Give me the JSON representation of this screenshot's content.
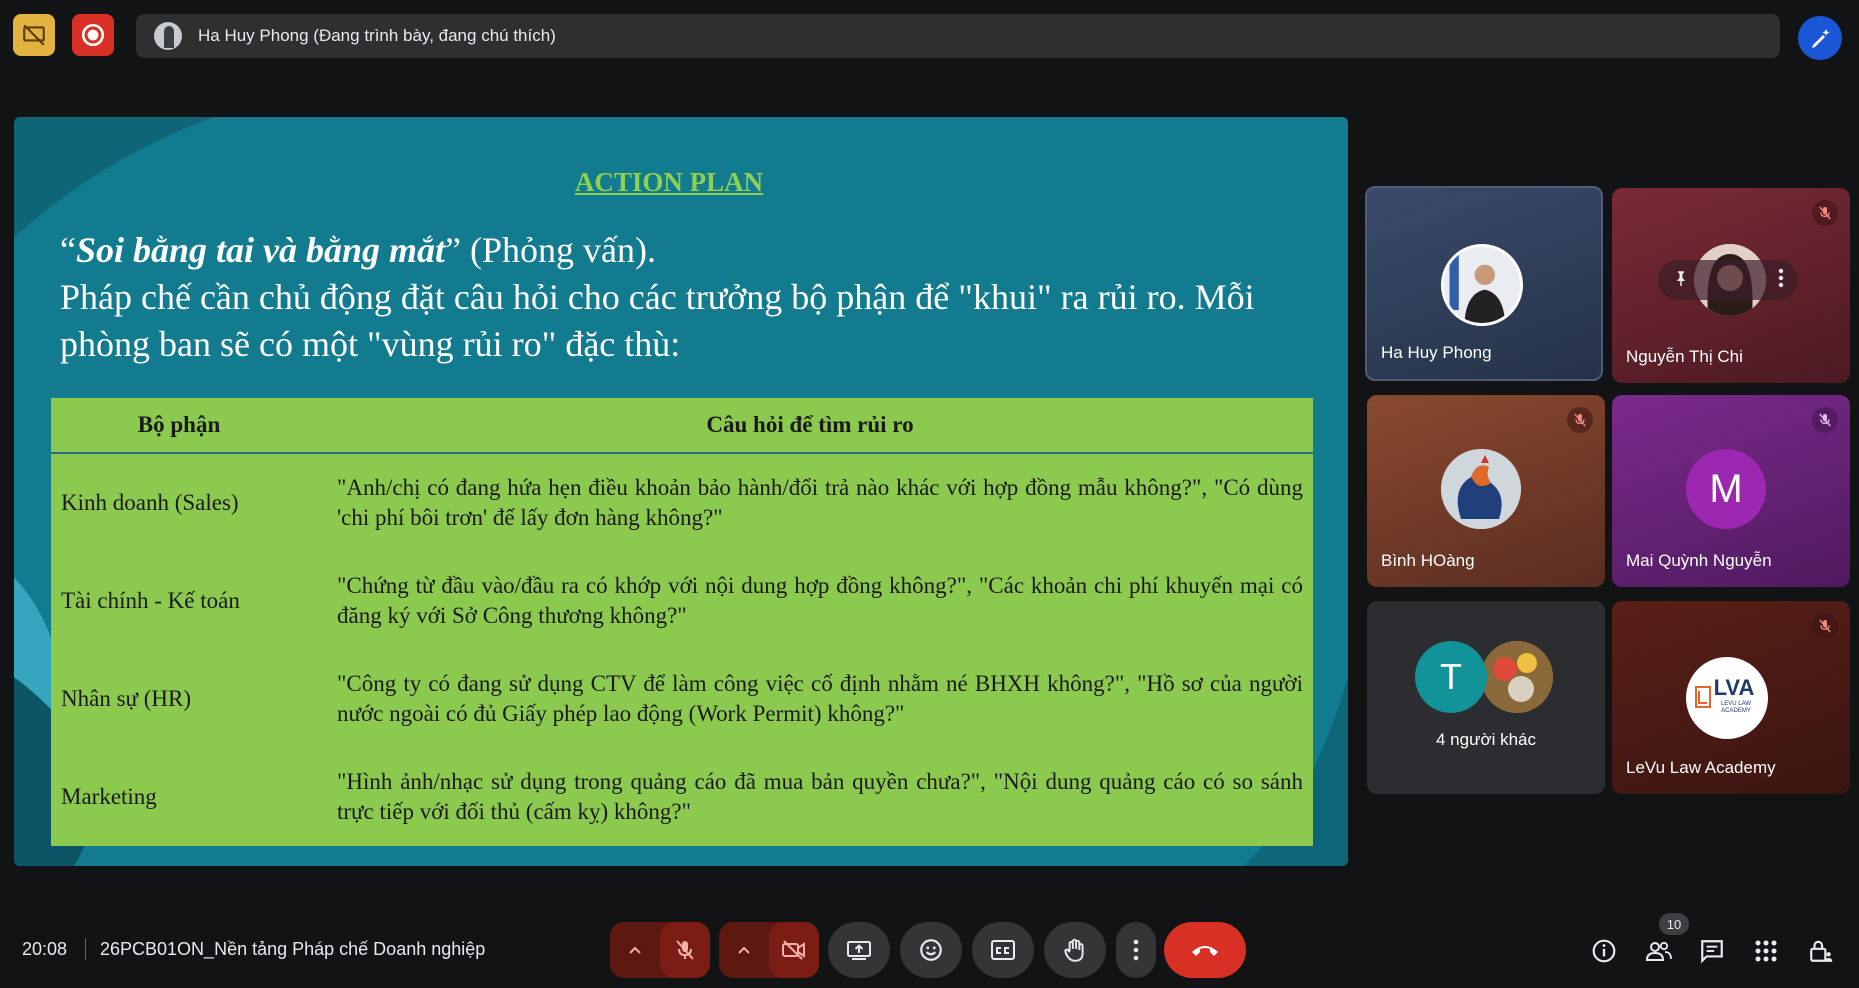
{
  "presenter_bar": {
    "text": "Ha Huy Phong (Đang trình bày, đang chú thích)"
  },
  "slide": {
    "title": "ACTION PLAN",
    "body_open_quote": "“",
    "body_emphasis": "Soi bằng tai và bằng mắt",
    "body_after_emphasis": "” (Phỏng vấn).",
    "body_line2": "Pháp chế cần chủ động đặt câu hỏi cho các trưởng bộ phận để \"khui\" ra rủi ro. Mỗi phòng ban sẽ có một \"vùng rủi ro\" đặc thù:",
    "table": {
      "headers": [
        "Bộ phận",
        "Câu hỏi để tìm rủi ro"
      ],
      "rows": [
        {
          "dept": "Kinh doanh (Sales)",
          "question": "\"Anh/chị có đang hứa hẹn điều khoản bảo hành/đổi trả nào khác với hợp đồng mẫu không?\", \"Có dùng 'chi phí bôi trơn' để lấy đơn hàng không?\""
        },
        {
          "dept": "Tài chính - Kế toán",
          "question": "\"Chứng từ đầu vào/đầu ra có khớp với nội dung hợp đồng không?\", \"Các khoản chi phí khuyến mại có đăng ký với Sở Công thương không?\""
        },
        {
          "dept": "Nhân sự (HR)",
          "question": "\"Công ty có đang sử dụng CTV để làm công việc cố định nhằm né BHXH không?\", \"Hồ sơ của người nước ngoài có đủ Giấy phép lao động (Work Permit) không?\""
        },
        {
          "dept": "Marketing",
          "question": "\"Hình ảnh/nhạc sử dụng trong quảng cáo đã mua bản quyền chưa?\", \"Nội dung quảng cáo có so sánh trực tiếp với đối thủ (cấm kỵ) không?\""
        }
      ]
    }
  },
  "participants": {
    "phong": {
      "name": "Ha Huy Phong"
    },
    "chi": {
      "name": "Nguyễn Thị Chi"
    },
    "binh": {
      "name": "Bình HOàng"
    },
    "mai": {
      "name": "Mai Quỳnh Nguyễn",
      "initial": "M"
    },
    "others": {
      "name": "4 người khác",
      "initial": "T"
    },
    "levu": {
      "name": "LeVu Law Academy",
      "logo_text": "LVA",
      "logo_sub": "LEVU LAW ACADEMY"
    }
  },
  "bottom_bar": {
    "time": "20:08",
    "meeting_title": "26PCB01ON_Nền tảng Pháp chế Doanh nghiệp",
    "people_count": "10"
  },
  "colors": {
    "accent_blue": "#1a57d6",
    "danger_red": "#d93025",
    "slide_bg": "#137a8f",
    "table_green": "#8cc94f",
    "title_green": "#8fd14f"
  }
}
